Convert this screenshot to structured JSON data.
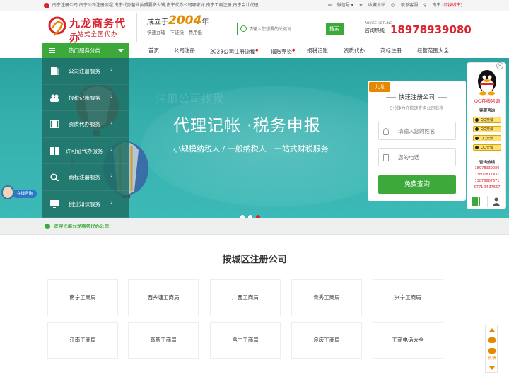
{
  "topbar": {
    "links": "南宁注册公司,南宁公司注册流程,南宁代办营业执照要多少钱,南宁代办公司哪家好,南宁工商注册,南宁会计代理",
    "wechat": "微信号",
    "favorite": "收藏本站",
    "contact": "联系客服",
    "city": "南宁",
    "switch_city": "[切换城市]"
  },
  "header": {
    "logo_title": "九龙商务代办",
    "logo_slogan": "一站式全国代办",
    "since_prefix": "成立于",
    "since_year": "2004",
    "since_suffix": "年",
    "since_sub": "快速办理　下证快　费用低",
    "search_placeholder": "请输入您想要的关键词",
    "search_button": "搜索",
    "hotline_en": "ADVICE HOTLINE",
    "hotline_cn": "咨询热线",
    "hotline_number": "18978939080"
  },
  "nav": {
    "category": "热门服务分类",
    "items": [
      {
        "label": "首页"
      },
      {
        "label": "公司注册"
      },
      {
        "label": "2023公司注册流程",
        "badge": "●"
      },
      {
        "label": "摆账竞资",
        "badge": "●"
      },
      {
        "label": "报税记账"
      },
      {
        "label": "资质代办"
      },
      {
        "label": "商标注册"
      },
      {
        "label": "经营范围大全"
      }
    ]
  },
  "sidebar": {
    "items": [
      {
        "label": "公司注册服务",
        "icon": "document-icon"
      },
      {
        "label": "报税记账服务",
        "icon": "people-icon"
      },
      {
        "label": "资质代办服务",
        "icon": "film-icon"
      },
      {
        "label": "许可证代办服务",
        "icon": "grid-icon"
      },
      {
        "label": "商标注册服务",
        "icon": "search-icon"
      },
      {
        "label": "创业知识服务",
        "icon": "monitor-icon"
      }
    ]
  },
  "banner": {
    "ghost": "注册公司找我",
    "headline": "代理记帐 ·税务申报",
    "subline": "小规模纳税人 / 一般纳税人　一站式财税服务",
    "slides": 3,
    "active_slide": 3
  },
  "form": {
    "tag": "九龙",
    "title": "快速注册公司",
    "subtitle": "5分钟为你快速查询公司名称",
    "name_placeholder": "请输入您的姓名",
    "phone_placeholder": "您的电话",
    "submit": "免费查询"
  },
  "welcome": {
    "text": "欢迎光临九龙商务代办公司！"
  },
  "section": {
    "title": "按城区注册公司",
    "cells": [
      "南宁工商局",
      "西乡塘工商局",
      "广西工商局",
      "青秀工商局",
      "兴宁工商局",
      "江南工商局",
      "高新工商局",
      "邕宁工商局",
      "良庆工商局",
      "工商电话大全"
    ]
  },
  "qq_panel": {
    "title": "QQ在线咨询",
    "service": "客服咨询",
    "btn": "QQ交谈",
    "hotline_title": "咨询热线",
    "phones": [
      "18978939080",
      "13807817431",
      "13878887671",
      "0771-5537667"
    ]
  },
  "online_float": {
    "label": "在线咨询"
  },
  "right_tools": {
    "feedback": "反馈"
  },
  "colors": {
    "green": "#3ca93a",
    "red": "#d9232d",
    "orange": "#e58a00",
    "teal": "#2aa3a0"
  }
}
